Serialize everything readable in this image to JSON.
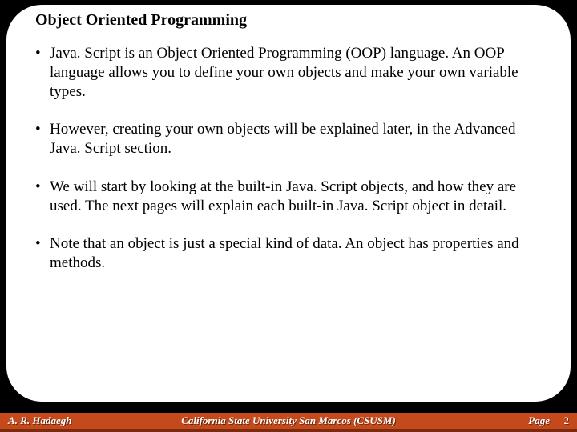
{
  "slide": {
    "title": "Object Oriented Programming",
    "bullets": [
      "Java. Script is an Object Oriented Programming (OOP) language. An OOP language allows you to define your own objects and make your own variable types.",
      "However, creating your own objects will be explained later, in the Advanced Java. Script section.",
      "We will start by looking at the built-in Java. Script objects, and how they are used. The next pages will explain each built-in Java. Script object in detail.",
      "Note that an object is just a special kind of data. An object has properties and methods."
    ]
  },
  "footer": {
    "author": "A. R. Hadaegh",
    "institution": "California State University San Marcos (CSUSM)",
    "page_label": "Page",
    "page_number": "2"
  }
}
